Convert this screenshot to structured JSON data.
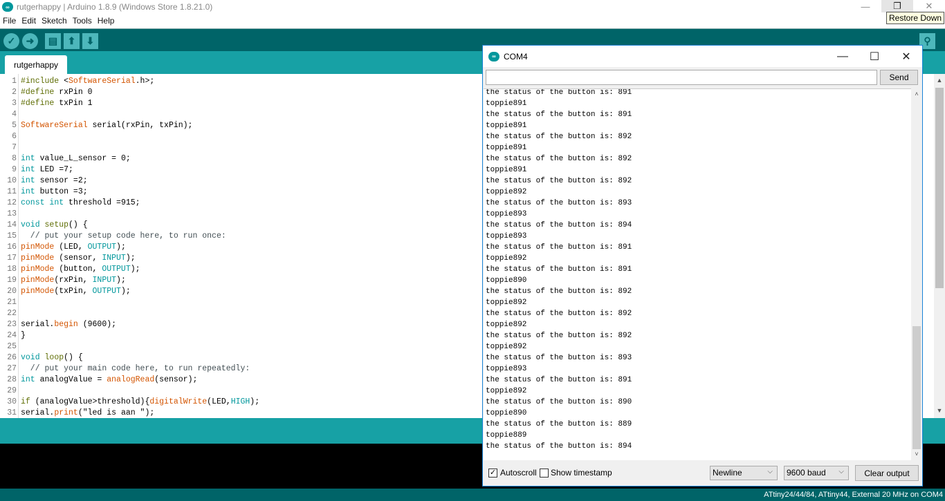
{
  "window": {
    "title": "rutgerhappy | Arduino 1.8.9 (Windows Store 1.8.21.0)",
    "tooltip": "Restore Down",
    "minimize": "—",
    "restore": "❐",
    "close": "✕"
  },
  "menu": [
    "File",
    "Edit",
    "Sketch",
    "Tools",
    "Help"
  ],
  "toolbar": {
    "verify": "✓",
    "upload": "➜",
    "new": "▤",
    "open": "⬆",
    "save": "⬇",
    "serial_monitor": "⚲"
  },
  "tab": {
    "label": "rutgerhappy"
  },
  "code": [
    [
      [
        "#include ",
        "pp"
      ],
      [
        "<",
        "tx"
      ],
      [
        "SoftwareSerial",
        "fn"
      ],
      [
        ".h>;",
        "tx"
      ]
    ],
    [
      [
        "#define ",
        "pp"
      ],
      [
        "rxPin 0",
        "tx"
      ]
    ],
    [
      [
        "#define ",
        "pp"
      ],
      [
        "txPin 1",
        "tx"
      ]
    ],
    [],
    [
      [
        "SoftwareSerial",
        "fn"
      ],
      [
        " serial(rxPin, txPin);",
        "tx"
      ]
    ],
    [],
    [],
    [
      [
        "int",
        "kw"
      ],
      [
        " value_L_sensor = 0;",
        "tx"
      ]
    ],
    [
      [
        "int",
        "kw"
      ],
      [
        " LED =7;",
        "tx"
      ]
    ],
    [
      [
        "int",
        "kw"
      ],
      [
        " sensor =2;",
        "tx"
      ]
    ],
    [
      [
        "int",
        "kw"
      ],
      [
        " button =3;",
        "tx"
      ]
    ],
    [
      [
        "const",
        "kw"
      ],
      [
        " ",
        "tx"
      ],
      [
        "int",
        "kw"
      ],
      [
        " threshold =915;",
        "tx"
      ]
    ],
    [],
    [
      [
        "void",
        "kw"
      ],
      [
        " ",
        "tx"
      ],
      [
        "setup",
        "pp"
      ],
      [
        "() {",
        "tx"
      ]
    ],
    [
      [
        "  // put your setup code here, to run once:",
        "cm"
      ]
    ],
    [
      [
        "pinMode",
        "fn"
      ],
      [
        " (LED, ",
        "tx"
      ],
      [
        "OUTPUT",
        "kw"
      ],
      [
        ");",
        "tx"
      ]
    ],
    [
      [
        "pinMode",
        "fn"
      ],
      [
        " (sensor, ",
        "tx"
      ],
      [
        "INPUT",
        "kw"
      ],
      [
        ");",
        "tx"
      ]
    ],
    [
      [
        "pinMode",
        "fn"
      ],
      [
        " (button, ",
        "tx"
      ],
      [
        "OUTPUT",
        "kw"
      ],
      [
        ");",
        "tx"
      ]
    ],
    [
      [
        "pinMode",
        "fn"
      ],
      [
        "(rxPin, ",
        "tx"
      ],
      [
        "INPUT",
        "kw"
      ],
      [
        ");",
        "tx"
      ]
    ],
    [
      [
        "pinMode",
        "fn"
      ],
      [
        "(txPin, ",
        "tx"
      ],
      [
        "OUTPUT",
        "kw"
      ],
      [
        ");",
        "tx"
      ]
    ],
    [],
    [],
    [
      [
        "serial.",
        "tx"
      ],
      [
        "begin",
        "fn"
      ],
      [
        " (9600);",
        "tx"
      ]
    ],
    [
      [
        "}",
        "tx"
      ]
    ],
    [],
    [
      [
        "void",
        "kw"
      ],
      [
        " ",
        "tx"
      ],
      [
        "loop",
        "pp"
      ],
      [
        "() {",
        "tx"
      ]
    ],
    [
      [
        "  // put your main code here, to run repeatedly:",
        "cm"
      ]
    ],
    [
      [
        "int",
        "kw"
      ],
      [
        " analogValue = ",
        "tx"
      ],
      [
        "analogRead",
        "fn"
      ],
      [
        "(sensor);",
        "tx"
      ]
    ],
    [],
    [
      [
        "if",
        "pp"
      ],
      [
        " (analogValue>threshold){",
        "tx"
      ],
      [
        "digitalWrite",
        "fn"
      ],
      [
        "(LED,",
        "tx"
      ],
      [
        "HIGH",
        "kw"
      ],
      [
        ");",
        "tx"
      ]
    ],
    [
      [
        "serial.",
        "tx"
      ],
      [
        "print",
        "fn"
      ],
      [
        "(\"led is aan \");",
        "tx"
      ]
    ]
  ],
  "status_bar": "ATtiny24/44/84, ATtiny44, External 20 MHz on COM4",
  "monitor": {
    "title": "COM4",
    "send": "Send",
    "input_value": "",
    "output": [
      "the status of the button is: 891",
      "toppie891",
      "the status of the button is: 891",
      "toppie891",
      "the status of the button is: 892",
      "toppie891",
      "the status of the button is: 892",
      "toppie891",
      "the status of the button is: 892",
      "toppie892",
      "the status of the button is: 893",
      "toppie893",
      "the status of the button is: 894",
      "toppie893",
      "the status of the button is: 891",
      "toppie892",
      "the status of the button is: 891",
      "toppie890",
      "the status of the button is: 892",
      "toppie892",
      "the status of the button is: 892",
      "toppie892",
      "the status of the button is: 892",
      "toppie892",
      "the status of the button is: 893",
      "toppie893",
      "the status of the button is: 891",
      "toppie892",
      "the status of the button is: 890",
      "toppie890",
      "the status of the button is: 889",
      "toppie889",
      "the status of the button is: 894"
    ],
    "autoscroll": "Autoscroll",
    "autoscroll_checked": true,
    "timestamp": "Show timestamp",
    "timestamp_checked": false,
    "line_ending": "Newline",
    "baud": "9600 baud",
    "clear": "Clear output"
  }
}
